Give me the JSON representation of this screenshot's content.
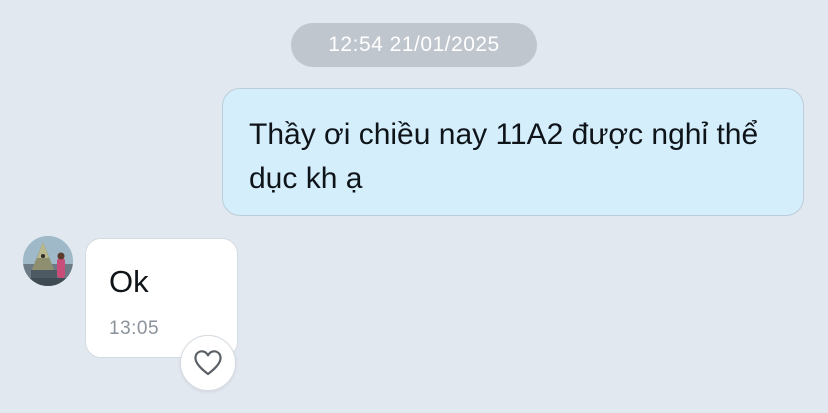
{
  "conversation": {
    "date_separator": "12:54 21/01/2025",
    "outgoing_message": {
      "text": "Thầy ơi chiều nay 11A2 được nghỉ thể dục kh ạ"
    },
    "incoming_message": {
      "text": "Ok",
      "time": "13:05",
      "reaction_icon": "heart-outline-icon"
    }
  },
  "colors": {
    "background": "#e2e8ef",
    "outgoing_bubble": "#d4eefc",
    "incoming_bubble": "#ffffff",
    "timestamp_pill": "#c0c6cd"
  }
}
